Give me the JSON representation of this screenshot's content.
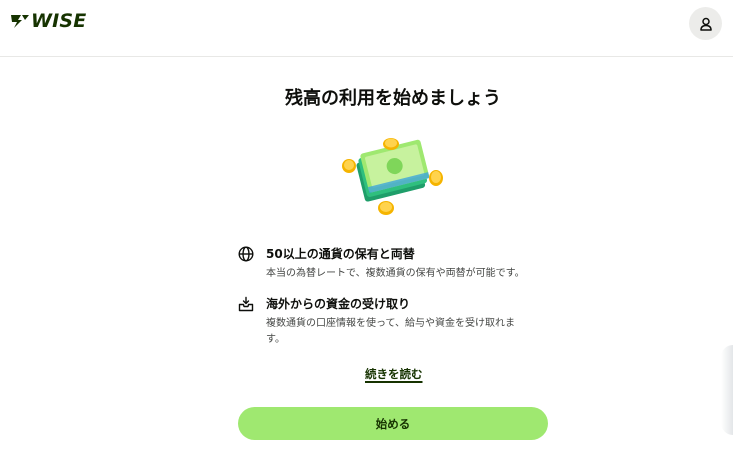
{
  "header": {
    "logo_text": "WISE",
    "account_icon": "person-icon"
  },
  "main": {
    "title": "残高の利用を始めましょう",
    "hero_image": "money-illustration",
    "features": [
      {
        "icon": "globe-icon",
        "title": "50以上の通貨の保有と両替",
        "description": "本当の為替レートで、複数通貨の保有や両替が可能です。"
      },
      {
        "icon": "inbox-receive-icon",
        "title": "海外からの資金の受け取り",
        "description": "複数通貨の口座情報を使って、給与や資金を受け取れます。"
      }
    ],
    "read_more": "続きを読む",
    "start_button": "始める"
  },
  "colors": {
    "brand_dark": "#163300",
    "brand_green": "#9fe870"
  }
}
